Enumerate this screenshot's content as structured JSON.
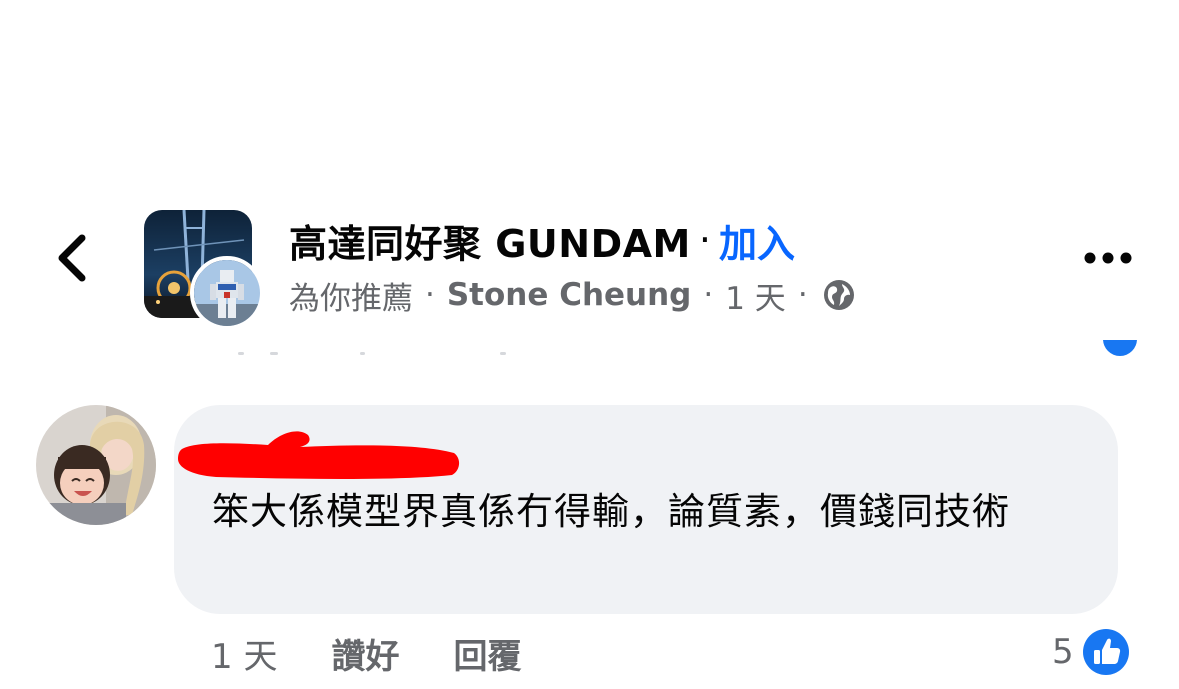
{
  "post_header": {
    "group_name": "高達同好聚 GUNDAM",
    "title_separator": "·",
    "join_label": "加入",
    "recommended_label": "為你推薦",
    "meta_separator": "·",
    "author": "Stone Cheung",
    "post_time": "1 天",
    "audience_icon": "globe-icon",
    "back_icon": "chevron-left-icon",
    "more_icon": "more-horizontal-icon"
  },
  "comment": {
    "author_redacted": true,
    "text": "笨大係模型界真係冇得輸，論質素，價錢同技術",
    "time": "1 天",
    "like_label": "讚好",
    "reply_label": "回覆",
    "reaction_count": "5",
    "reaction_icon": "thumbs-up-icon"
  },
  "colors": {
    "accent_blue": "#0866ff",
    "like_blue": "#1877f2",
    "secondary_text": "#65676b",
    "bubble_bg": "#f0f2f5",
    "redaction_red": "#ff0000"
  }
}
